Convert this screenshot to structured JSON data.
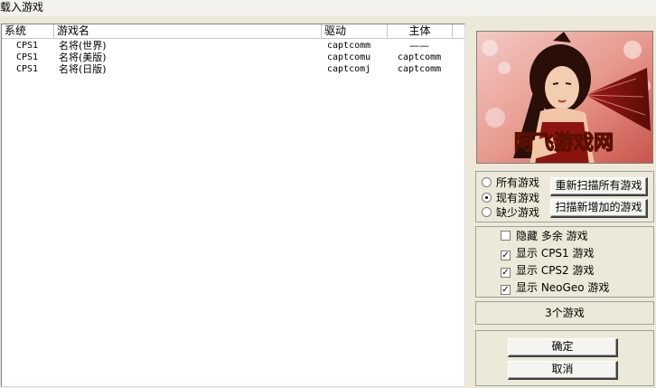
{
  "window": {
    "title": "载入游戏"
  },
  "list": {
    "columns": [
      "系统",
      "游戏名",
      "驱动",
      "主体"
    ],
    "rows": [
      {
        "system": "CPS1",
        "name": "名将(世界)",
        "driver": "captcomm",
        "parent": "——"
      },
      {
        "system": "CPS1",
        "name": "名将(美版)",
        "driver": "captcomu",
        "parent": "captcomm"
      },
      {
        "system": "CPS1",
        "name": "名将(日版)",
        "driver": "captcomj",
        "parent": "captcomm"
      }
    ]
  },
  "preview": {
    "banner_text": "阿飞游戏网"
  },
  "filters": {
    "radios": [
      {
        "label": "所有游戏",
        "selected": false
      },
      {
        "label": "现有游戏",
        "selected": true
      },
      {
        "label": "缺少游戏",
        "selected": false
      }
    ],
    "rescan_all_label": "重新扫描所有游戏",
    "scan_new_label": "扫描新增加的游戏"
  },
  "options": [
    {
      "label": "隐藏 多余 游戏",
      "checked": false
    },
    {
      "label": "显示 CPS1 游戏",
      "checked": true
    },
    {
      "label": "显示 CPS2 游戏",
      "checked": true
    },
    {
      "label": "显示 NeoGeo 游戏",
      "checked": true
    }
  ],
  "status": {
    "count_text": "3个游戏"
  },
  "actions": {
    "ok_label": "确定",
    "cancel_label": "取消"
  },
  "colors": {
    "background": "#ece9d8",
    "list_background": "#ffffff"
  }
}
